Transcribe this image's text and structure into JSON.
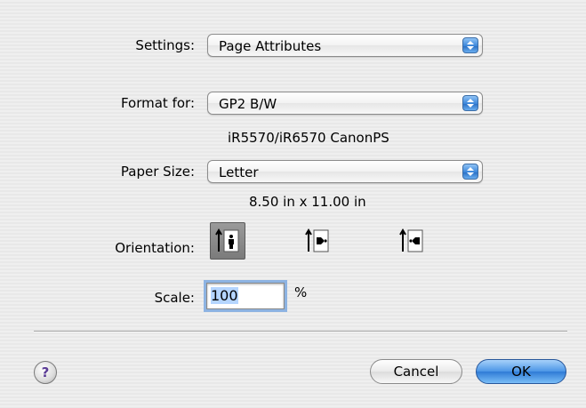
{
  "settings": {
    "label": "Settings:",
    "value": "Page Attributes"
  },
  "format_for": {
    "label": "Format for:",
    "value": "GP2 B/W",
    "printer_model": "iR5570/iR6570 CanonPS"
  },
  "paper_size": {
    "label": "Paper Size:",
    "value": "Letter",
    "dimensions": "8.50 in x 11.00 in"
  },
  "orientation": {
    "label": "Orientation:",
    "options": [
      "portrait-icon",
      "landscape-icon",
      "reverse-landscape-icon"
    ],
    "selected": 0
  },
  "scale": {
    "label": "Scale:",
    "value": "100",
    "unit": "%"
  },
  "buttons": {
    "cancel": "Cancel",
    "ok": "OK",
    "help": "?"
  },
  "colors": {
    "accent": "#3a85d9",
    "ok_button": "#4a95e6",
    "background": "#ececec"
  }
}
